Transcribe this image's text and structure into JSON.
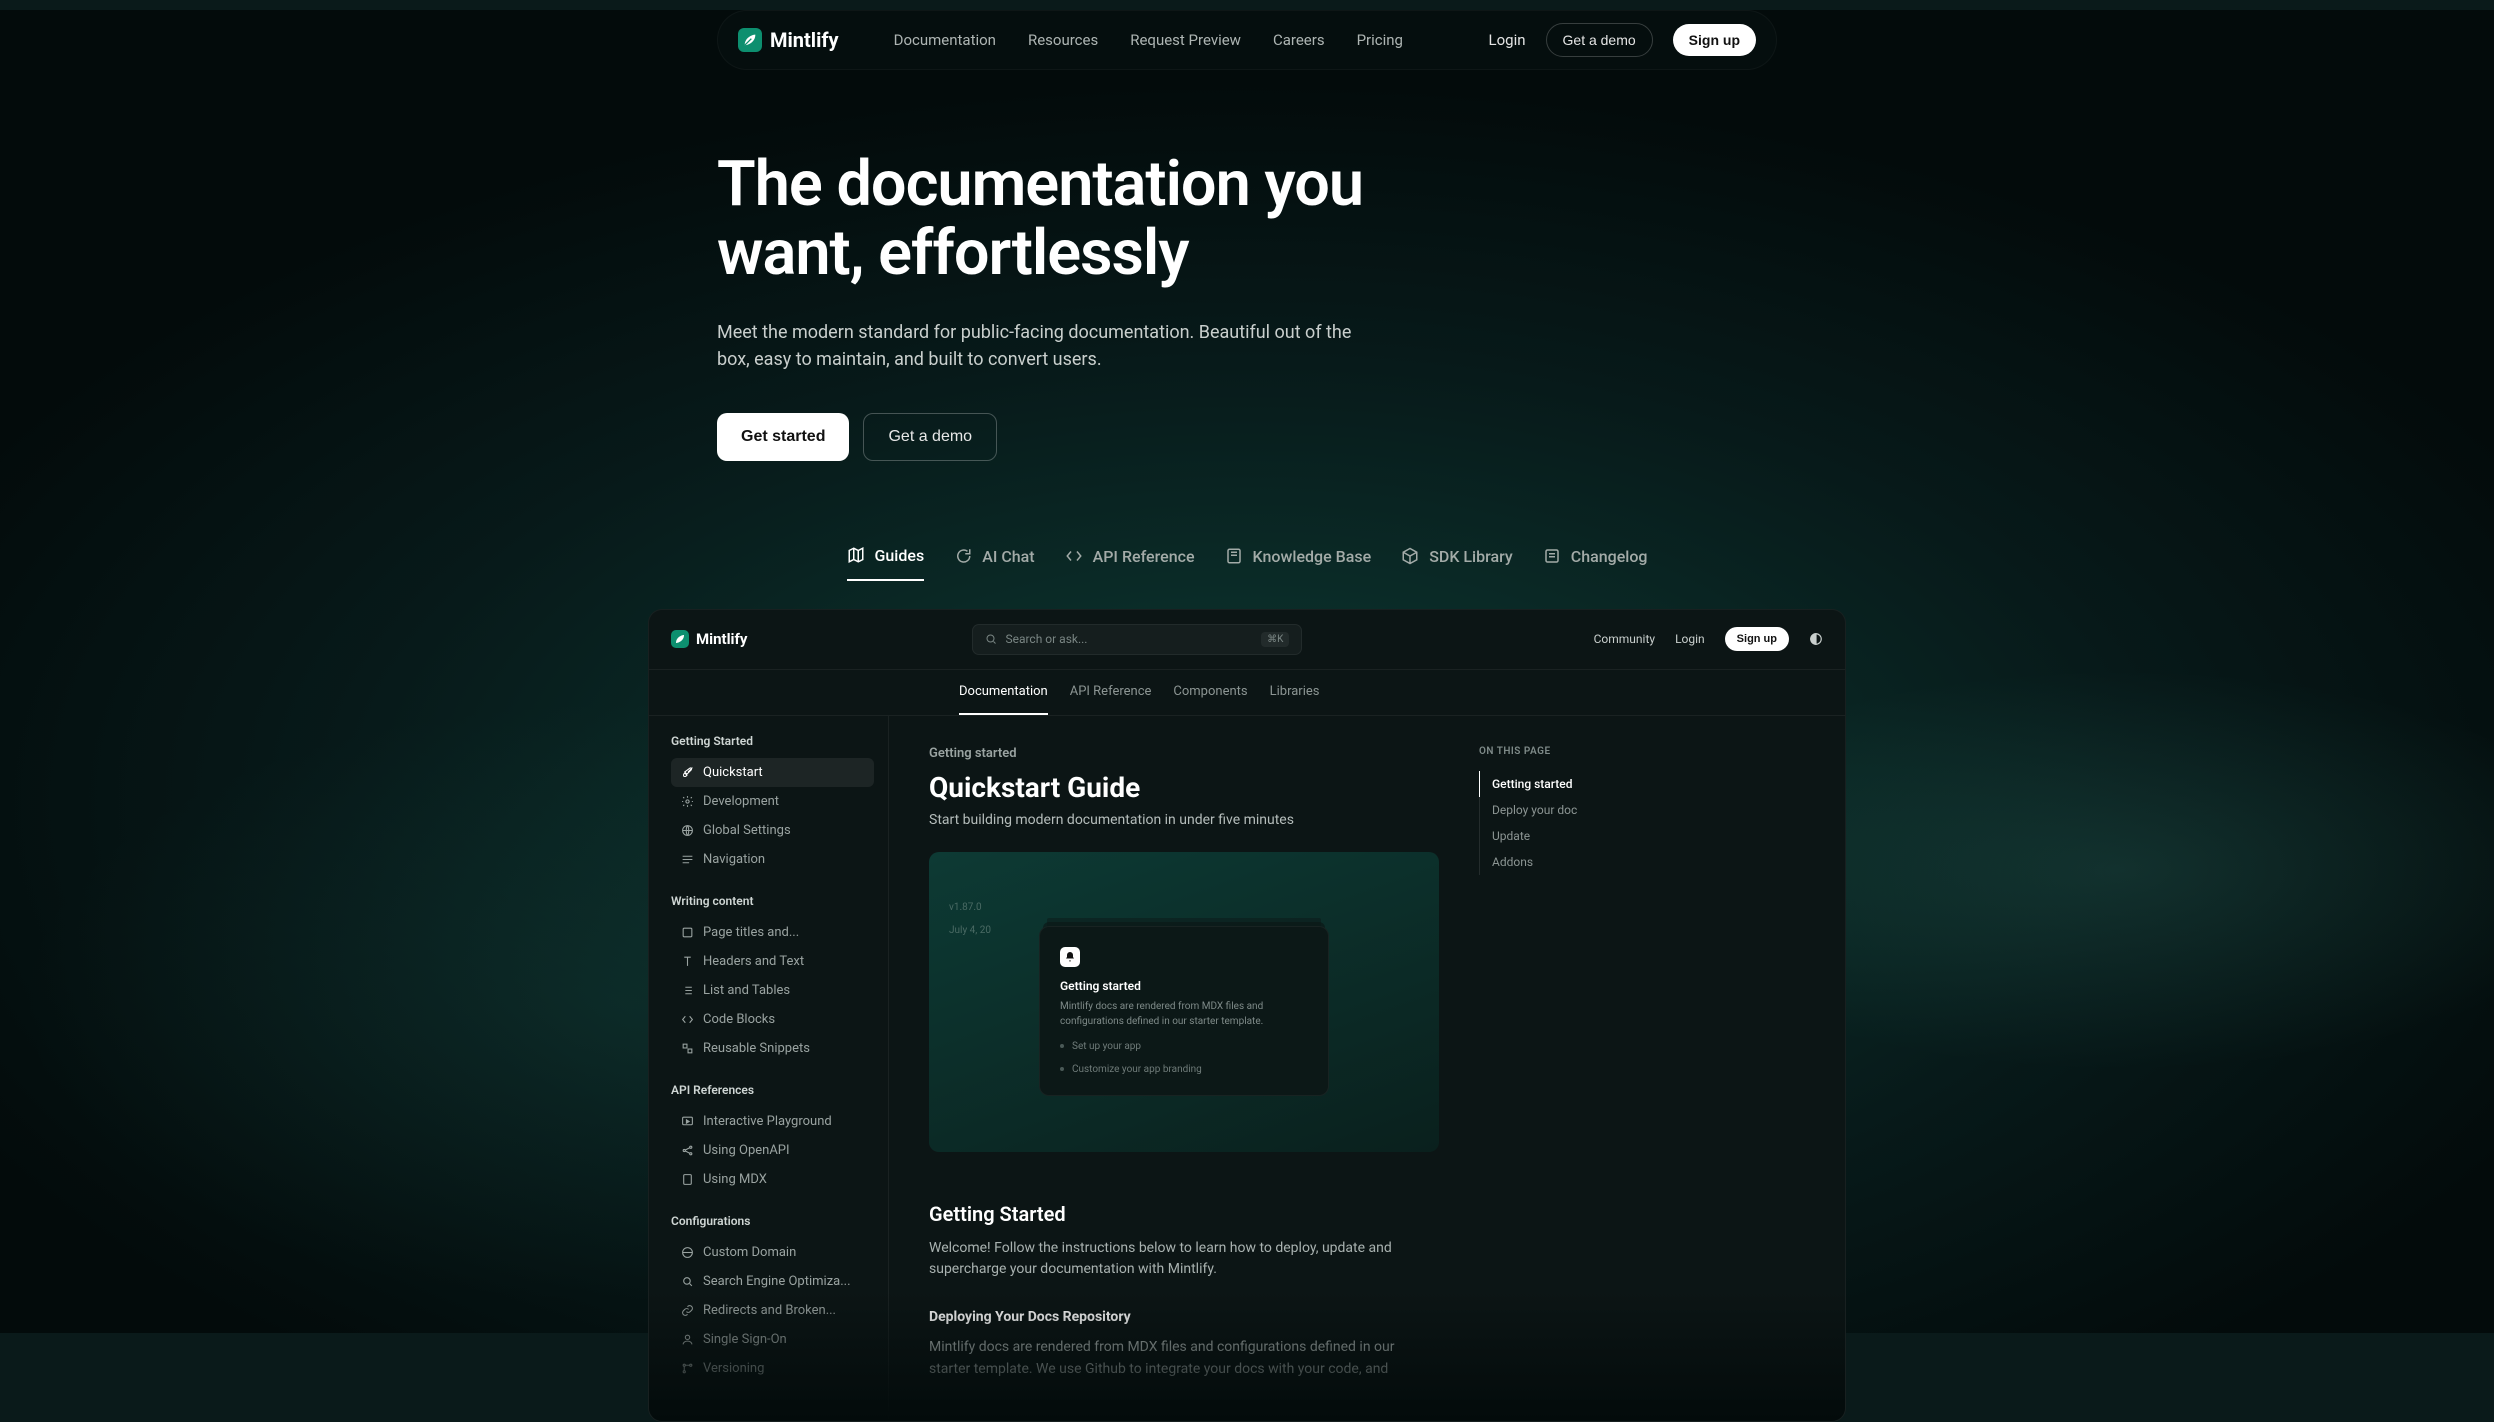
{
  "brand": "Mintlify",
  "nav": {
    "links": [
      "Documentation",
      "Resources",
      "Request Preview",
      "Careers",
      "Pricing"
    ],
    "login": "Login",
    "demo": "Get a demo",
    "signup": "Sign up"
  },
  "hero": {
    "title_l1": "The documentation you",
    "title_l2": "want, effortlessly",
    "subtitle": "Meet the modern standard for public-facing documentation. Beautiful out of the box, easy to maintain, and built to convert users.",
    "cta_primary": "Get started",
    "cta_secondary": "Get a demo"
  },
  "feature_tabs": [
    "Guides",
    "AI Chat",
    "API Reference",
    "Knowledge Base",
    "SDK Library",
    "Changelog"
  ],
  "preview": {
    "brand": "Mintlify",
    "search_placeholder": "Search or ask...",
    "search_kbd": "⌘K",
    "toplinks": {
      "community": "Community",
      "login": "Login",
      "signup": "Sign up"
    },
    "tabs": [
      "Documentation",
      "API Reference",
      "Components",
      "Libraries"
    ],
    "side_tabs": {
      "getting_started": "Getting Started",
      "quickstart": "Quickstart"
    },
    "sidebar": {
      "s1": {
        "heading": "Getting Started",
        "items": [
          "Quickstart",
          "Development",
          "Global Settings",
          "Navigation"
        ]
      },
      "s2": {
        "heading": "Writing content",
        "items": [
          "Page titles and...",
          "Headers and Text",
          "List and Tables",
          "Code Blocks",
          "Reusable Snippets"
        ]
      },
      "s3": {
        "heading": "API References",
        "items": [
          "Interactive Playground",
          "Using OpenAPI",
          "Using MDX"
        ]
      },
      "s4": {
        "heading": "Configurations",
        "items": [
          "Custom Domain",
          "Search Engine Optimiza...",
          "Redirects and Broken...",
          "Single Sign-On",
          "Versioning"
        ]
      }
    },
    "content": {
      "crumb": "Getting started",
      "h1": "Quickstart Guide",
      "lead": "Start building modern documentation in under five minutes",
      "card_meta1": "v1.87.0",
      "card_meta2": "July 4, 20",
      "card_title": "Getting started",
      "card_desc": "Mintlify docs are rendered from MDX files and configurations defined in our starter template.",
      "card_step1": "Set up your app",
      "card_step2": "Customize your app branding",
      "h2": "Getting Started",
      "p1": "Welcome! Follow the instructions below to learn how to deploy, update and supercharge your documentation with Mintlify.",
      "h3": "Deploying Your Docs Repository",
      "p2": "Mintlify docs are rendered from MDX files and configurations defined in our starter template. We use Github to integrate your docs with your code, and"
    },
    "toc": {
      "label": "On this page",
      "items": [
        "Getting started",
        "Deploy your doc",
        "Update",
        "Addons"
      ]
    }
  }
}
